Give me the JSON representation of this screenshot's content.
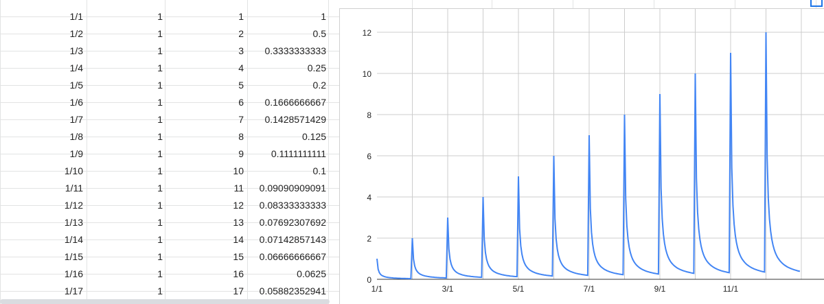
{
  "table": {
    "rows": [
      {
        "a": "1/1",
        "b": "1",
        "c": "1",
        "d": "1"
      },
      {
        "a": "1/2",
        "b": "1",
        "c": "2",
        "d": "0.5"
      },
      {
        "a": "1/3",
        "b": "1",
        "c": "3",
        "d": "0.3333333333"
      },
      {
        "a": "1/4",
        "b": "1",
        "c": "4",
        "d": "0.25"
      },
      {
        "a": "1/5",
        "b": "1",
        "c": "5",
        "d": "0.2"
      },
      {
        "a": "1/6",
        "b": "1",
        "c": "6",
        "d": "0.1666666667"
      },
      {
        "a": "1/7",
        "b": "1",
        "c": "7",
        "d": "0.1428571429"
      },
      {
        "a": "1/8",
        "b": "1",
        "c": "8",
        "d": "0.125"
      },
      {
        "a": "1/9",
        "b": "1",
        "c": "9",
        "d": "0.1111111111"
      },
      {
        "a": "1/10",
        "b": "1",
        "c": "10",
        "d": "0.1"
      },
      {
        "a": "1/11",
        "b": "1",
        "c": "11",
        "d": "0.09090909091"
      },
      {
        "a": "1/12",
        "b": "1",
        "c": "12",
        "d": "0.08333333333"
      },
      {
        "a": "1/13",
        "b": "1",
        "c": "13",
        "d": "0.07692307692"
      },
      {
        "a": "1/14",
        "b": "1",
        "c": "14",
        "d": "0.07142857143"
      },
      {
        "a": "1/15",
        "b": "1",
        "c": "15",
        "d": "0.06666666667"
      },
      {
        "a": "1/16",
        "b": "1",
        "c": "16",
        "d": "0.0625"
      },
      {
        "a": "1/17",
        "b": "1",
        "c": "17",
        "d": "0.05882352941"
      }
    ]
  },
  "chart_data": {
    "type": "line",
    "title": "",
    "xlabel": "",
    "ylabel": "",
    "x_ticks": [
      "1/1",
      "3/1",
      "5/1",
      "7/1",
      "9/1",
      "11/1"
    ],
    "y_ticks": [
      0,
      2,
      4,
      6,
      8,
      10,
      12
    ],
    "ylim": [
      0,
      12
    ],
    "grid": true,
    "line_color": "#4285f4",
    "series": [
      {
        "peaks": [
          {
            "x": "1/1",
            "y": 1
          },
          {
            "x": "2/1",
            "y": 2
          },
          {
            "x": "3/1",
            "y": 3
          },
          {
            "x": "4/1",
            "y": 4
          },
          {
            "x": "5/1",
            "y": 5
          },
          {
            "x": "6/1",
            "y": 6
          },
          {
            "x": "7/1",
            "y": 7
          },
          {
            "x": "8/1",
            "y": 8
          },
          {
            "x": "9/1",
            "y": 9
          },
          {
            "x": "10/1",
            "y": 10
          },
          {
            "x": "11/1",
            "y": 11
          },
          {
            "x": "12/1",
            "y": 12
          }
        ]
      }
    ]
  },
  "colors": {
    "grid": "#cccccc",
    "axis": "#222222",
    "accent": "#1a73e8"
  }
}
